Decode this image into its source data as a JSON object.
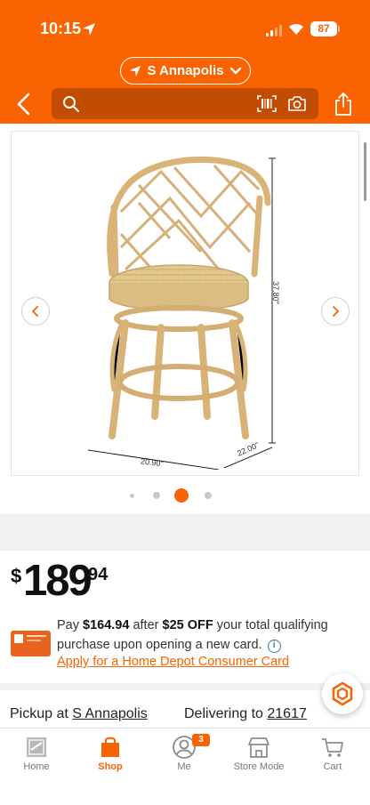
{
  "status_bar": {
    "time": "10:15",
    "battery": "87"
  },
  "header": {
    "store_selector": "S Annapolis",
    "search_placeholder": ""
  },
  "product_image": {
    "dimensions": {
      "height": "37.80\"",
      "width": "20.90\"",
      "depth": "22.00\""
    },
    "dots": {
      "count": 4,
      "active_index": 2
    }
  },
  "price": {
    "currency": "$",
    "dollars": "189",
    "cents": "94"
  },
  "promo": {
    "pay_prefix": "Pay ",
    "discounted_price": "$164.94",
    "after_text": " after ",
    "discount": "$25 OFF",
    "rest": " your total qualifying purchase upon opening a new card.",
    "apply_link": "Apply for a Home Depot Consumer Card"
  },
  "fulfillment": {
    "pickup_label": "Pickup at ",
    "pickup_store": "S Annapolis",
    "delivery_label": "Delivering to ",
    "zip": "21617"
  },
  "bottom_nav": {
    "home": "Home",
    "shop": "Shop",
    "me": "Me",
    "me_badge": "3",
    "store_mode": "Store Mode",
    "cart": "Cart",
    "active": "shop"
  },
  "colors": {
    "brand_orange": "#f96302",
    "search_bg": "#c24d00",
    "link_blue": "#3e7697"
  }
}
